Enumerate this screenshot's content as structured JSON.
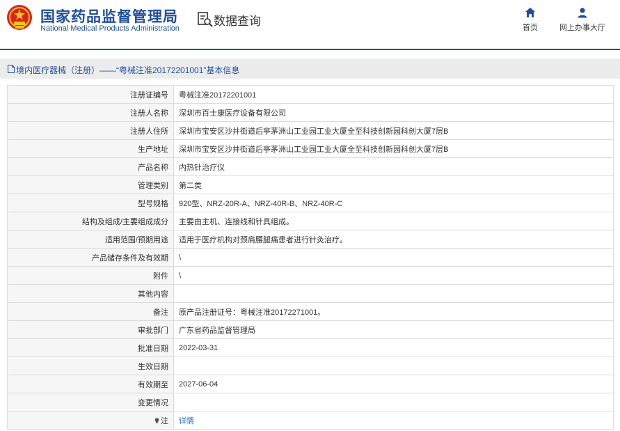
{
  "header": {
    "title_cn": "国家药品监督管理局",
    "title_en": "National Medical Products Administration",
    "query_title": "数据查询",
    "nav": {
      "home": "首页",
      "office": "网上办事大厅"
    }
  },
  "breadcrumb": {
    "text": "境内医疗器械（注册）——“粤械注准20172201001”基本信息"
  },
  "rows": [
    {
      "label": "注册证编号",
      "value": "粤械注准20172201001"
    },
    {
      "label": "注册人名称",
      "value": "深圳市百士康医疗设备有限公司"
    },
    {
      "label": "注册人住所",
      "value": "深圳市宝安区沙井街道后亭茅洲山工业园工业大厦全至科技创新园科创大厦7层B"
    },
    {
      "label": "生产地址",
      "value": "深圳市宝安区沙井街道后亭茅洲山工业园工业大厦全至科技创新园科创大厦7层B"
    },
    {
      "label": "产品名称",
      "value": "内热针治疗仪"
    },
    {
      "label": "管理类别",
      "value": "第二类"
    },
    {
      "label": "型号规格",
      "value": "920型、NRZ-20R-A、NRZ-40R-B、NRZ-40R-C"
    },
    {
      "label": "结构及组成/主要组成成分",
      "value": "主要由主机、连接线和针具组成。"
    },
    {
      "label": "适用范围/预期用途",
      "value": "适用于医疗机构对颈肩腰腿痛患者进行针灸治疗。"
    },
    {
      "label": "产品储存条件及有效期",
      "value": "\\"
    },
    {
      "label": "附件",
      "value": "\\"
    },
    {
      "label": "其他内容",
      "value": ""
    },
    {
      "label": "备注",
      "value": "原产品注册证号：粤械注准20172271001。"
    },
    {
      "label": "审批部门",
      "value": "广东省药品监督管理局"
    },
    {
      "label": "批准日期",
      "value": "2022-03-31"
    },
    {
      "label": "生效日期",
      "value": ""
    },
    {
      "label": "有效期至",
      "value": "2027-06-04"
    },
    {
      "label": "变更情况",
      "value": ""
    }
  ],
  "note_row": {
    "label": "注",
    "link": "详情"
  },
  "colors": {
    "brand_blue": "#1f4f9c",
    "link_blue": "#1f6fc0",
    "emblem_red": "#d7261e",
    "emblem_gold": "#f5c518"
  },
  "icons": {
    "emblem": "national-emblem-icon",
    "query": "document-search-icon",
    "home": "home-icon",
    "office": "user-icon",
    "crumb": "document-icon",
    "note": "pin-icon"
  }
}
